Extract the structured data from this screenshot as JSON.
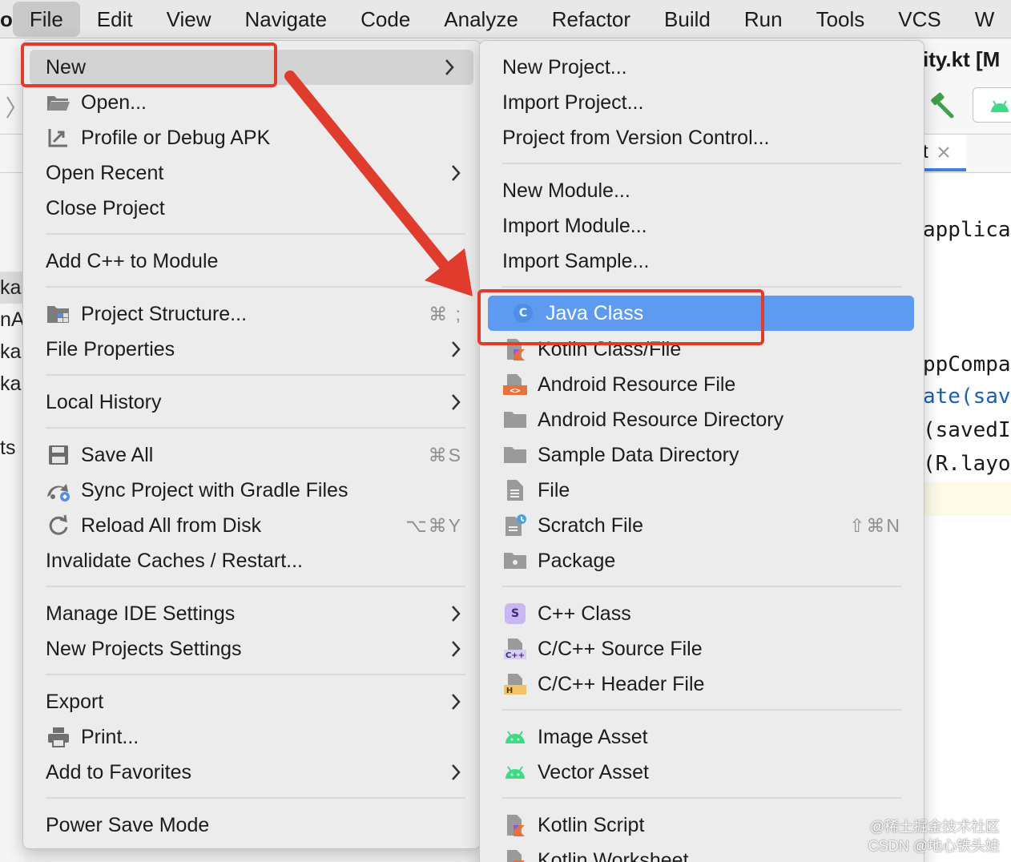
{
  "menubar": {
    "app": "o",
    "items": [
      "File",
      "Edit",
      "View",
      "Navigate",
      "Code",
      "Analyze",
      "Refactor",
      "Build",
      "Run",
      "Tools",
      "VCS",
      "W"
    ]
  },
  "ide": {
    "title_fragment": "ity.kt [M",
    "tab_fragment": "t",
    "left_fragments": [
      "kar",
      "nA",
      "kar",
      "kar",
      "ts"
    ],
    "code_lines": [
      "applica",
      "ppCompa",
      "ate(sav",
      "(savedI",
      "(R.layo"
    ]
  },
  "file_menu": {
    "new": "New",
    "open": "Open...",
    "profile_debug": "Profile or Debug APK",
    "open_recent": "Open Recent",
    "close_project": "Close Project",
    "add_cpp": "Add C++ to Module",
    "project_structure": "Project Structure...",
    "project_structure_shortcut": "⌘ ;",
    "file_properties": "File Properties",
    "local_history": "Local History",
    "save_all": "Save All",
    "save_all_shortcut": "⌘S",
    "sync_gradle": "Sync Project with Gradle Files",
    "reload_disk": "Reload All from Disk",
    "reload_disk_shortcut": "⌥⌘Y",
    "invalidate": "Invalidate Caches / Restart...",
    "manage_ide": "Manage IDE Settings",
    "new_projects_settings": "New Projects Settings",
    "export": "Export",
    "print": "Print...",
    "favorites": "Add to Favorites",
    "power_save": "Power Save Mode"
  },
  "new_menu": {
    "new_project": "New Project...",
    "import_project": "Import Project...",
    "vcs_project": "Project from Version Control...",
    "new_module": "New Module...",
    "import_module": "Import Module...",
    "import_sample": "Import Sample...",
    "java_class": "Java Class",
    "kotlin_class": "Kotlin Class/File",
    "android_resource_file": "Android Resource File",
    "android_resource_dir": "Android Resource Directory",
    "sample_data_dir": "Sample Data Directory",
    "file": "File",
    "scratch_file": "Scratch File",
    "scratch_shortcut": "⇧⌘N",
    "package": "Package",
    "cpp_class": "C++ Class",
    "cpp_source": "C/C++ Source File",
    "cpp_header": "C/C++ Header File",
    "image_asset": "Image Asset",
    "vector_asset": "Vector Asset",
    "kotlin_script": "Kotlin Script",
    "kotlin_worksheet": "Kotlin Worksheet"
  },
  "icons": {
    "java_badge": "C",
    "cpp_badge": "S",
    "cpp_source_badge": "C++",
    "cpp_header_badge": "H",
    "resource_badge": "<>"
  },
  "watermark": {
    "line1": "@稀土掘金技术社区",
    "line2": "CSDN @地心铁头娃"
  },
  "colors": {
    "highlight_blue": "#5e9bf0",
    "annotation_red": "#e03c2d",
    "android_green": "#3ddc84"
  }
}
